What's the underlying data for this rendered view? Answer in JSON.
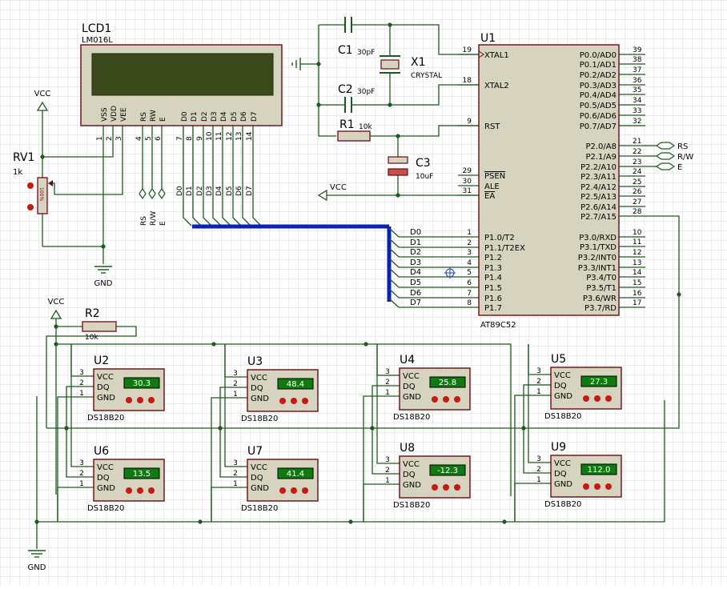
{
  "lcd": {
    "ref": "LCD1",
    "part": "LM016L",
    "pin_labels": [
      "VSS",
      "VDD",
      "VEE",
      "RS",
      "RW",
      "E",
      "D0",
      "D1",
      "D2",
      "D3",
      "D4",
      "D5",
      "D6",
      "D7"
    ],
    "pin_numbers": [
      "1",
      "2",
      "3",
      "4",
      "5",
      "6",
      "7",
      "8",
      "9",
      "10",
      "11",
      "12",
      "13",
      "14"
    ]
  },
  "lcd_terminals": {
    "ctrl": [
      "RS",
      "R/W",
      "E"
    ],
    "data": [
      "D0",
      "D1",
      "D2",
      "D3",
      "D4",
      "D5",
      "D6",
      "D7"
    ]
  },
  "mcu": {
    "ref": "U1",
    "part": "AT89C52",
    "left_pins": [
      {
        "num": "19",
        "name": "XTAL1"
      },
      {
        "num": "18",
        "name": "XTAL2"
      },
      {
        "num": "9",
        "name": "RST"
      },
      {
        "num": "29",
        "name": "PSEN"
      },
      {
        "num": "30",
        "name": "ALE"
      },
      {
        "num": "31",
        "name": "EA"
      },
      {
        "num": "1",
        "name": "P1.0/T2"
      },
      {
        "num": "2",
        "name": "P1.1/T2EX"
      },
      {
        "num": "3",
        "name": "P1.2"
      },
      {
        "num": "4",
        "name": "P1.3"
      },
      {
        "num": "5",
        "name": "P1.4"
      },
      {
        "num": "6",
        "name": "P1.5"
      },
      {
        "num": "7",
        "name": "P1.6"
      },
      {
        "num": "8",
        "name": "P1.7"
      }
    ],
    "right_pins": [
      {
        "num": "39",
        "name": "P0.0/AD0"
      },
      {
        "num": "38",
        "name": "P0.1/AD1"
      },
      {
        "num": "37",
        "name": "P0.2/AD2"
      },
      {
        "num": "36",
        "name": "P0.3/AD3"
      },
      {
        "num": "35",
        "name": "P0.4/AD4"
      },
      {
        "num": "34",
        "name": "P0.5/AD5"
      },
      {
        "num": "33",
        "name": "P0.6/AD6"
      },
      {
        "num": "32",
        "name": "P0.7/AD7"
      },
      {
        "num": "21",
        "name": "P2.0/A8"
      },
      {
        "num": "22",
        "name": "P2.1/A9"
      },
      {
        "num": "23",
        "name": "P2.2/A10"
      },
      {
        "num": "24",
        "name": "P2.3/A11"
      },
      {
        "num": "25",
        "name": "P2.4/A12"
      },
      {
        "num": "26",
        "name": "P2.5/A13"
      },
      {
        "num": "27",
        "name": "P2.6/A14"
      },
      {
        "num": "28",
        "name": "P2.7/A15"
      },
      {
        "num": "10",
        "name": "P3.0/RXD"
      },
      {
        "num": "11",
        "name": "P3.1/TXD"
      },
      {
        "num": "12",
        "name": "P3.2/INT0"
      },
      {
        "num": "13",
        "name": "P3.3/INT1"
      },
      {
        "num": "14",
        "name": "P3.4/T0"
      },
      {
        "num": "15",
        "name": "P3.5/T1"
      },
      {
        "num": "16",
        "name": "P3.6/WR"
      },
      {
        "num": "17",
        "name": "P3.7/RD"
      }
    ]
  },
  "bus_labels": [
    "D0",
    "D1",
    "D2",
    "D3",
    "D4",
    "D5",
    "D6",
    "D7"
  ],
  "mcu_terminals": [
    "RS",
    "R/W",
    "E"
  ],
  "passives": {
    "c1": {
      "ref": "C1",
      "value": "30pF"
    },
    "c2": {
      "ref": "C2",
      "value": "30pF"
    },
    "x1": {
      "ref": "X1",
      "value": "CRYSTAL"
    },
    "r1": {
      "ref": "R1",
      "value": "10k"
    },
    "c3": {
      "ref": "C3",
      "value": "10uF"
    },
    "rv1": {
      "ref": "RV1",
      "value": "1k",
      "body": "100%"
    },
    "r2": {
      "ref": "R2",
      "value": "10k"
    }
  },
  "power": {
    "vcc": "VCC",
    "gnd": "GND"
  },
  "sensors": [
    {
      "ref": "U2",
      "reading": "30.3",
      "part": "DS18B20"
    },
    {
      "ref": "U3",
      "reading": "48.4",
      "part": "DS18B20"
    },
    {
      "ref": "U4",
      "reading": "25.8",
      "part": "DS18B20"
    },
    {
      "ref": "U5",
      "reading": "27.3",
      "part": "DS18B20"
    },
    {
      "ref": "U6",
      "reading": "13.5",
      "part": "DS18B20"
    },
    {
      "ref": "U7",
      "reading": "41.4",
      "part": "DS18B20"
    },
    {
      "ref": "U8",
      "reading": "-12.3",
      "part": "DS18B20"
    },
    {
      "ref": "U9",
      "reading": "112.0",
      "part": "DS18B20"
    }
  ],
  "sensor_pins": {
    "labels": [
      "VCC",
      "DQ",
      "GND"
    ],
    "numbers": [
      "3",
      "2",
      "1"
    ]
  },
  "colors": {
    "wire": "#1e5a1e",
    "bus": "#0a22b4",
    "body": "#d6d4be",
    "outline": "#6a0a14",
    "lcd_screen": "#3a4a1a",
    "display": "#0f7a0f",
    "display_text": "#ffffff",
    "text": "#000000",
    "power": "#1e5a1e",
    "pin_dot": "#c41a10"
  }
}
